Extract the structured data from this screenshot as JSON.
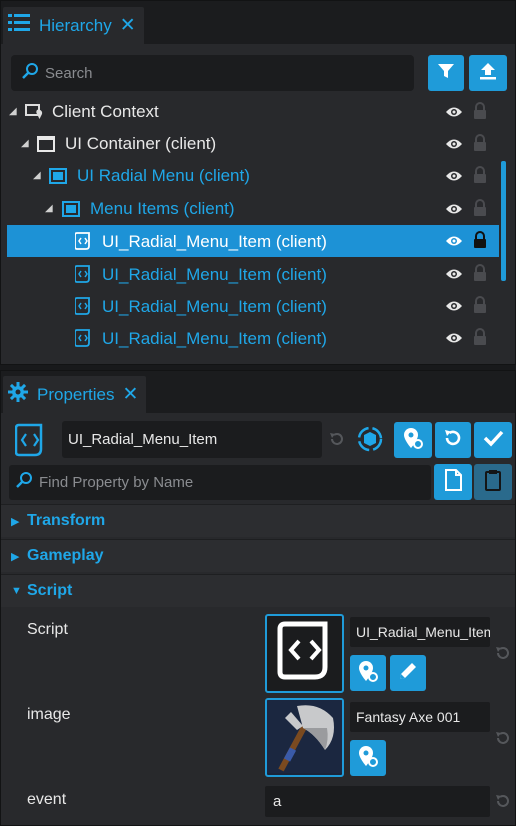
{
  "hierarchy": {
    "tab_label": "Hierarchy",
    "search_placeholder": "Search",
    "tree": [
      {
        "label": "Client Context",
        "icon": "client-context-icon"
      },
      {
        "label": "UI Container (client)",
        "icon": "ui-container-icon"
      },
      {
        "label": "UI Radial Menu (client)",
        "icon": "ui-panel-icon"
      },
      {
        "label": "Menu Items (client)",
        "icon": "ui-panel-icon"
      },
      {
        "label": "UI_Radial_Menu_Item (client)",
        "icon": "script-icon"
      },
      {
        "label": "UI_Radial_Menu_Item (client)",
        "icon": "script-icon"
      },
      {
        "label": "UI_Radial_Menu_Item (client)",
        "icon": "script-icon"
      },
      {
        "label": "UI_Radial_Menu_Item (client)",
        "icon": "script-icon"
      }
    ]
  },
  "properties": {
    "tab_label": "Properties",
    "object_name": "UI_Radial_Menu_Item",
    "find_placeholder": "Find Property by Name",
    "sections": {
      "transform": "Transform",
      "gameplay": "Gameplay",
      "script": "Script"
    },
    "fields": {
      "script_label": "Script",
      "script_value": "UI_Radial_Menu_Item",
      "image_label": "image",
      "image_value": "Fantasy Axe 001",
      "event_label": "event",
      "event_value": "a"
    }
  },
  "colors": {
    "accent": "#1f9bd9",
    "text_blue": "#1fa7e8",
    "panel": "#28292c",
    "field": "#1b1c1e"
  }
}
